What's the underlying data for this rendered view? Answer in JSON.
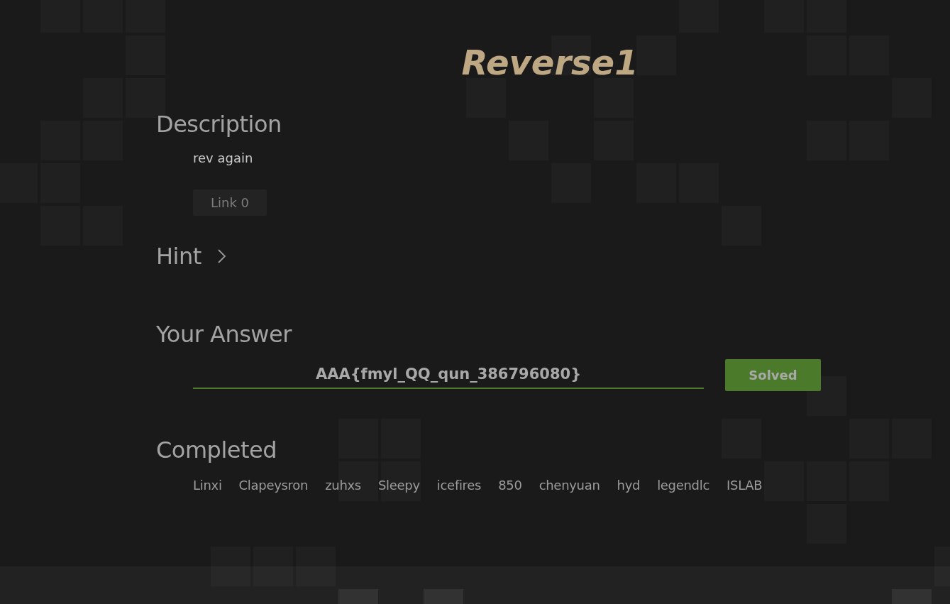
{
  "title": "Reverse1",
  "description": {
    "heading": "Description",
    "text": "rev again",
    "links": [
      {
        "label": "Link 0"
      }
    ]
  },
  "hint": {
    "heading": "Hint",
    "expanded": false
  },
  "answer": {
    "heading": "Your Answer",
    "value": "AAA{fmyl_QQ_qun_386796080}",
    "status": "Solved",
    "solved": true
  },
  "completed": {
    "heading": "Completed",
    "users": [
      "Linxi",
      "Clapeysron",
      "zuhxs",
      "Sleepy",
      "icefires",
      "850",
      "chenyuan",
      "hyd",
      "legendlc",
      "ISLAB"
    ]
  }
}
